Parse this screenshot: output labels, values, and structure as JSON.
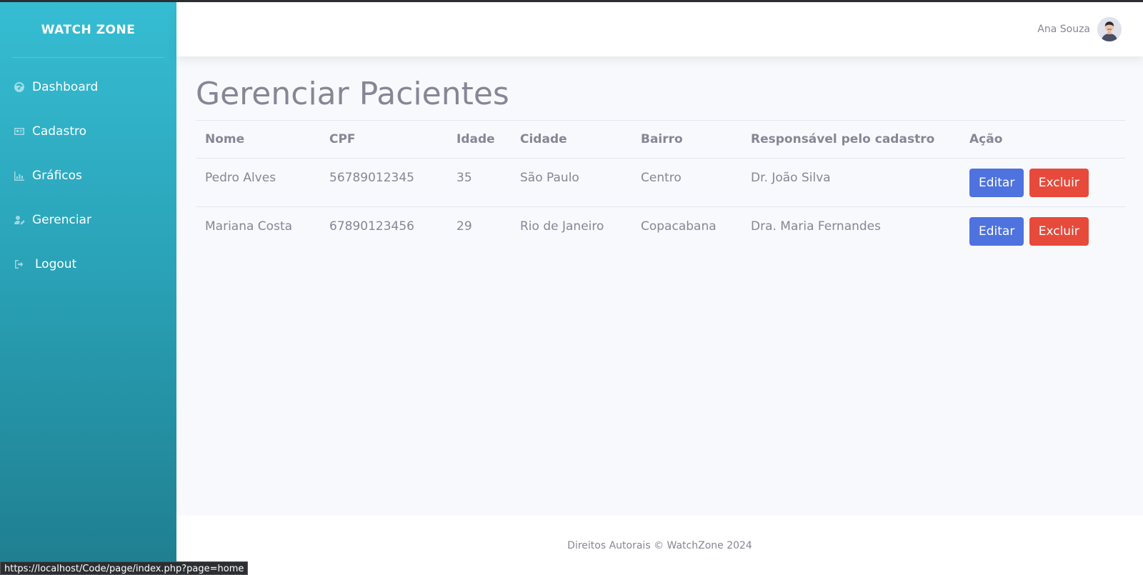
{
  "brand": "WATCH ZONE",
  "sidebar": {
    "items": [
      {
        "label": "Dashboard",
        "icon": "dashboard-icon"
      },
      {
        "label": "Cadastro",
        "icon": "id-card-icon"
      },
      {
        "label": "Gráficos",
        "icon": "chart-icon"
      },
      {
        "label": "Gerenciar",
        "icon": "user-edit-icon"
      },
      {
        "label": "Logout",
        "icon": "sign-out-icon"
      }
    ]
  },
  "topbar": {
    "user_name": "Ana Souza"
  },
  "page": {
    "title": "Gerenciar Pacientes"
  },
  "table": {
    "headers": [
      "Nome",
      "CPF",
      "Idade",
      "Cidade",
      "Bairro",
      "Responsável pelo cadastro",
      "Ação"
    ],
    "rows": [
      {
        "nome": "Pedro Alves",
        "cpf": "56789012345",
        "idade": "35",
        "cidade": "São Paulo",
        "bairro": "Centro",
        "responsavel": "Dr. João Silva"
      },
      {
        "nome": "Mariana Costa",
        "cpf": "67890123456",
        "idade": "29",
        "cidade": "Rio de Janeiro",
        "bairro": "Copacabana",
        "responsavel": "Dra. Maria Fernandes"
      }
    ],
    "edit_label": "Editar",
    "delete_label": "Excluir"
  },
  "footer": {
    "text": "Direitos Autorais © WatchZone 2024"
  },
  "statusbar": {
    "url": "https://localhost/Code/page/index.php?page=home"
  },
  "colors": {
    "sidebar_top": "#36bdd3",
    "sidebar_bottom": "#1f7e8f",
    "edit_button": "#4e73df",
    "delete_button": "#e74a3b"
  }
}
